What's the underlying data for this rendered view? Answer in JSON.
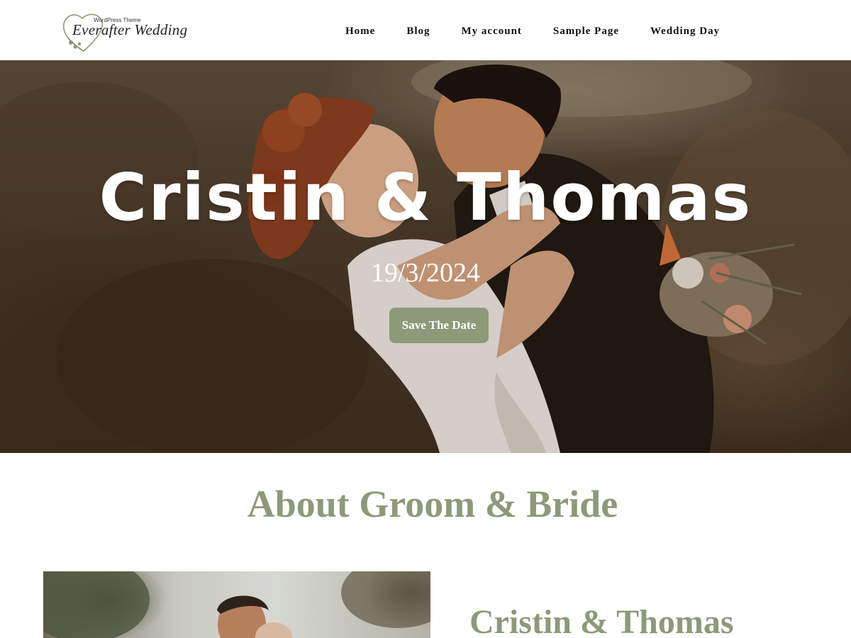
{
  "header": {
    "logo": {
      "tagline": "WordPress Theme",
      "name": "Everafter Wedding"
    },
    "nav": [
      {
        "label": "Home"
      },
      {
        "label": "Blog"
      },
      {
        "label": "My account"
      },
      {
        "label": "Sample Page"
      },
      {
        "label": "Wedding Day"
      }
    ]
  },
  "hero": {
    "title": "Cristin & Thomas",
    "date": "19/3/2024",
    "button_label": "Save The Date"
  },
  "about": {
    "title": "About Groom & Bride",
    "couple_name": "Cristin & Thomas"
  },
  "colors": {
    "accent": "#8c9a7a",
    "text_dark": "#111111",
    "hero_text": "#ffffff"
  }
}
